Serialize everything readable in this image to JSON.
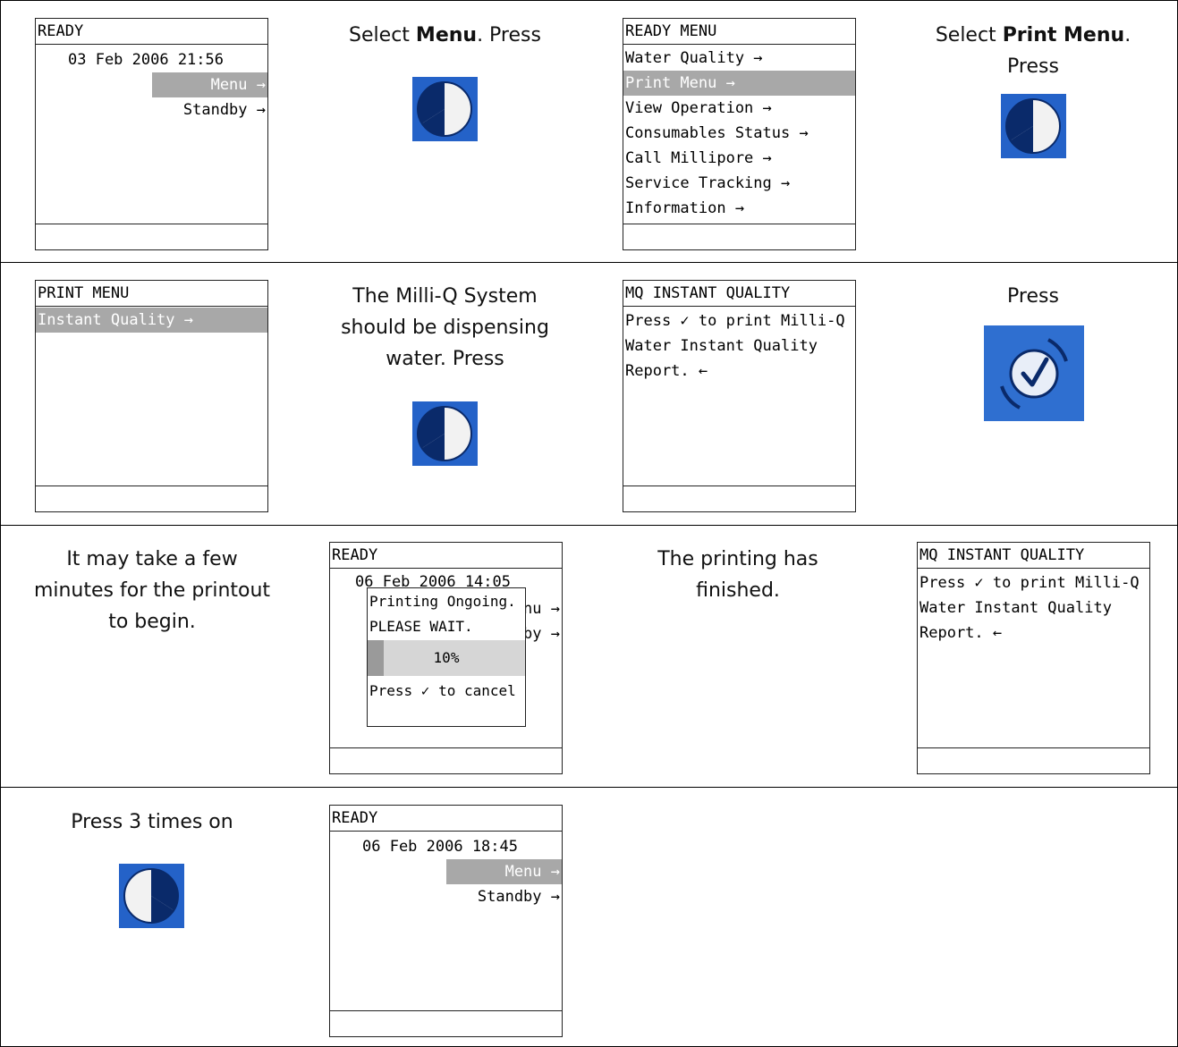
{
  "rows": [
    {
      "c1_screen": {
        "title": "READY",
        "datetime": "03 Feb 2006 21:56",
        "menu": "Menu →",
        "standby": "Standby →"
      },
      "c2_instruction": {
        "pre": "Select ",
        "bold": "Menu",
        "post": ".  Press"
      },
      "c3_screen": {
        "title": "READY MENU",
        "items": [
          "Water Quality →",
          "Print Menu →",
          "View Operation →",
          "Consumables Status →",
          "Call Millipore →",
          "Service Tracking →",
          "Information →"
        ]
      },
      "c4_instruction": {
        "pre": "Select ",
        "bold": "Print Menu",
        "post": ".",
        "line2": "Press"
      }
    },
    {
      "c1_screen": {
        "title": "PRINT MENU",
        "item": "Instant Quality →"
      },
      "c2_instruction": {
        "lines": [
          "The Milli-Q System",
          "should be dispensing",
          "water.  Press"
        ]
      },
      "c3_screen": {
        "title": "MQ INSTANT QUALITY",
        "lines": [
          "Press ✓ to print Milli-Q",
          "Water Instant Quality",
          "Report. ←"
        ]
      },
      "c4_instruction": {
        "text": "Press"
      }
    },
    {
      "c1_instruction": {
        "lines": [
          "It may take a few",
          "minutes for the printout",
          "to begin."
        ]
      },
      "c2_screen": {
        "title": "READY",
        "datetime": "06 Feb 2006 14:05",
        "menu_partial": "nu →",
        "standby_partial": "by →",
        "popup_line1": "Printing Ongoing.",
        "popup_line2": "PLEASE WAIT.",
        "progress_label": "10%",
        "progress": 0.1,
        "popup_line3": "Press ✓ to cancel"
      },
      "c3_instruction": {
        "lines": [
          "The printing has",
          "finished."
        ]
      },
      "c4_screen": {
        "title": "MQ INSTANT QUALITY",
        "lines": [
          "Press ✓ to print Milli-Q",
          "Water Instant Quality",
          "Report. ←"
        ]
      }
    },
    {
      "c1_instruction": {
        "text": "Press 3 times on"
      },
      "c2_screen": {
        "title": "READY",
        "datetime": "06 Feb 2006 18:45",
        "menu": "Menu →",
        "standby": "Standby →"
      }
    }
  ],
  "icons": {
    "right": "right-arrow-button-icon",
    "left": "left-arrow-button-icon",
    "ok": "ok-check-button-icon"
  },
  "colors": {
    "button_blue": "#2462c8",
    "highlight": "#a8a8a8"
  }
}
